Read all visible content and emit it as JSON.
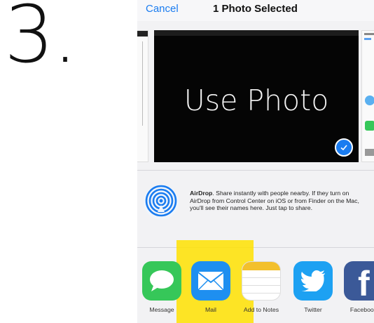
{
  "step_label": "3.",
  "nav": {
    "cancel_label": "Cancel",
    "title": "1 Photo Selected"
  },
  "photo": {
    "text": "Use Photo",
    "selected": true
  },
  "airdrop": {
    "title": "AirDrop",
    "description": ". Share instantly with people nearby. If they turn on AirDrop from Control Center on iOS or from Finder on the Mac, you'll see their names here. Just tap to share."
  },
  "apps": [
    {
      "label": "Message",
      "icon": "message-icon"
    },
    {
      "label": "Mail",
      "icon": "mail-icon"
    },
    {
      "label": "Add to Notes",
      "icon": "notes-icon"
    },
    {
      "label": "Twitter",
      "icon": "twitter-icon"
    },
    {
      "label": "Facebook",
      "icon": "facebook-icon"
    }
  ],
  "colors": {
    "accent": "#1a7cf0",
    "highlight": "#ffe200",
    "messages": "#36c759",
    "twitter": "#1da1f2",
    "facebook": "#3b5998"
  }
}
